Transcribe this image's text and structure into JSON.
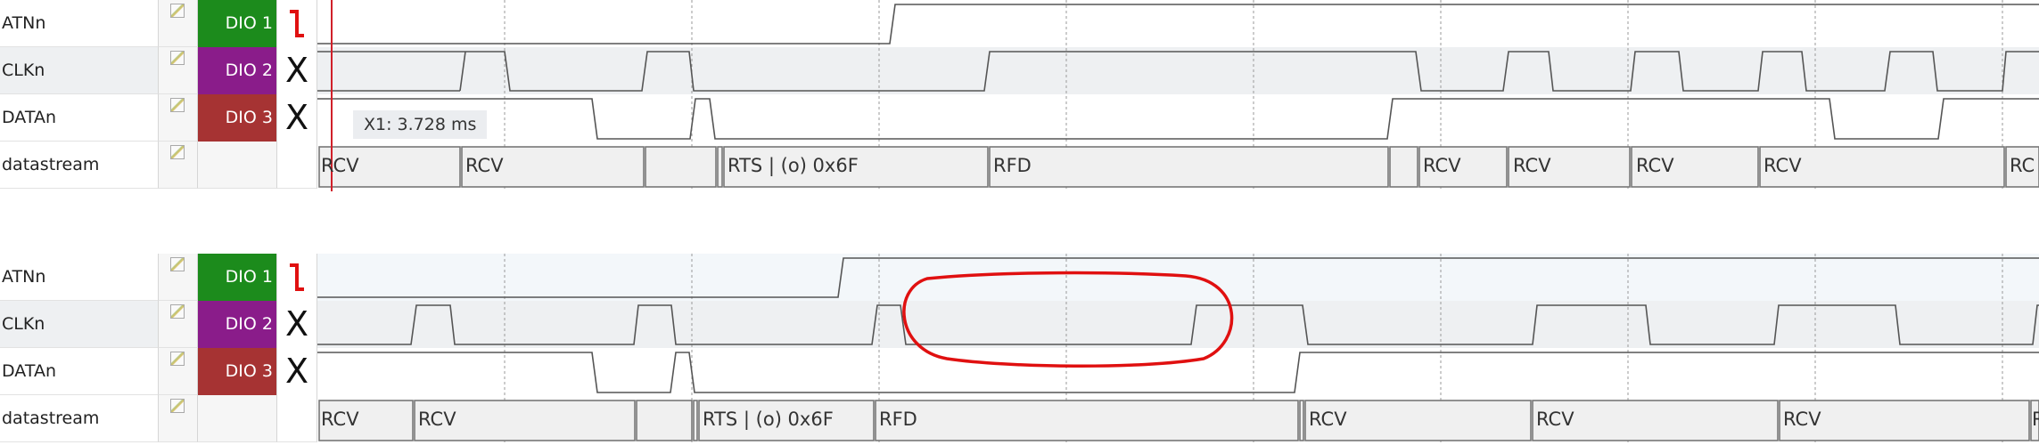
{
  "channels": [
    {
      "name": "ATNn",
      "badge": "DIO  1",
      "color": "#1c8b1c",
      "trigger": "falling-edge"
    },
    {
      "name": "CLKn",
      "badge": "DIO  2",
      "color": "#8a1c8a",
      "trigger": "X"
    },
    {
      "name": "DATAn",
      "badge": "DIO  3",
      "color": "#a63333",
      "trigger": "X"
    },
    {
      "name": "datastream",
      "badge": "",
      "color": "",
      "trigger": ""
    }
  ],
  "cursor": {
    "label": "X1: 3.728 ms",
    "color": "#d0202a"
  },
  "panel1": {
    "segments": [
      "RCV",
      "RCV",
      "",
      "",
      "RTS | (o) 0x6F",
      "RFD",
      "",
      "RCV",
      "RCV",
      "RCV",
      "RCV",
      "RC"
    ]
  },
  "panel2": {
    "segments": [
      "RCV",
      "RCV",
      "",
      "RTS | (o) 0x6F",
      "RFD",
      "",
      "RCV",
      "RCV",
      "RCV",
      "R"
    ],
    "annotation": "highlight-ellipse"
  },
  "colors": {
    "accent_red": "#e01010",
    "wave": "#555555",
    "bus": "#777777"
  }
}
